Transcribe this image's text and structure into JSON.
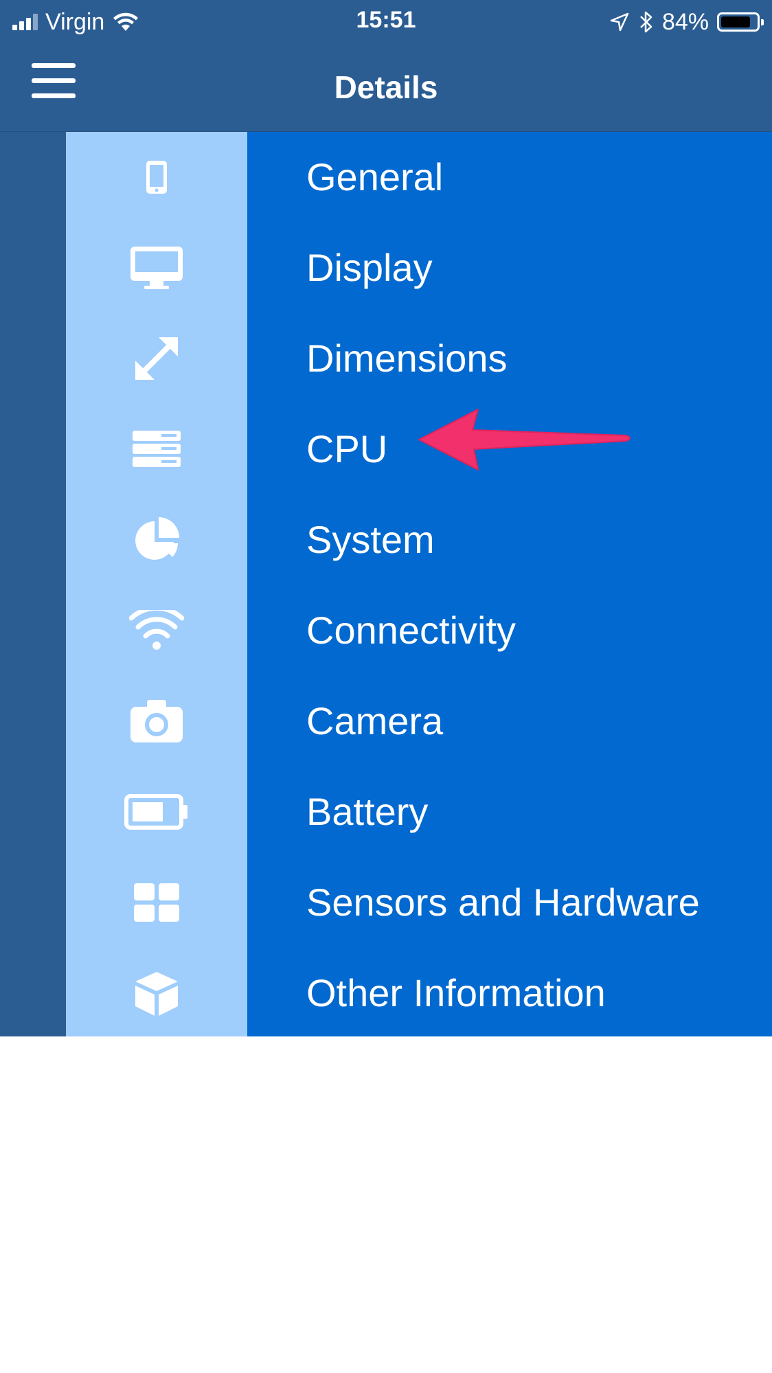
{
  "status_bar": {
    "carrier": "Virgin",
    "time": "15:51",
    "battery_percent": "84%",
    "battery_level": 0.84,
    "icons": [
      "signal-icon",
      "wifi-icon",
      "location-arrow-icon",
      "bluetooth-icon",
      "battery-icon"
    ]
  },
  "nav": {
    "title": "Details",
    "menu_icon": "hamburger-menu-icon"
  },
  "menu": {
    "items": [
      {
        "label": "General",
        "icon": "phone-icon"
      },
      {
        "label": "Display",
        "icon": "monitor-icon"
      },
      {
        "label": "Dimensions",
        "icon": "expand-arrows-icon"
      },
      {
        "label": "CPU",
        "icon": "server-icon"
      },
      {
        "label": "System",
        "icon": "pie-chart-icon"
      },
      {
        "label": "Connectivity",
        "icon": "wifi-icon"
      },
      {
        "label": "Camera",
        "icon": "camera-icon"
      },
      {
        "label": "Battery",
        "icon": "battery-icon"
      },
      {
        "label": "Sensors and Hardware",
        "icon": "grid-icon"
      },
      {
        "label": "Other Information",
        "icon": "cube-icon"
      }
    ],
    "highlighted_item": "CPU"
  },
  "annotation": {
    "icon": "pointer-arrow-icon",
    "color": "#f2306c"
  },
  "colors": {
    "header_bg": "#2b5d93",
    "icon_column_bg": "#9fcdfc",
    "label_column_bg": "#0169cf",
    "text": "#ffffff"
  }
}
